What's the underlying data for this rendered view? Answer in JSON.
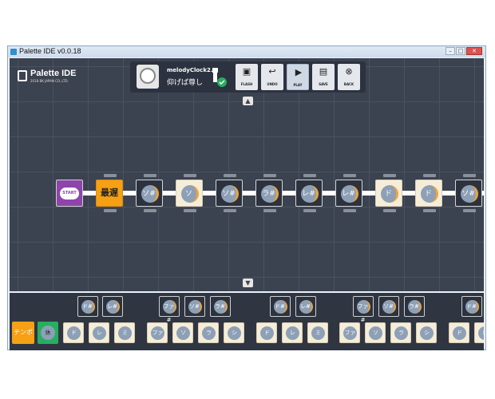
{
  "window": {
    "title": "Palette IDE v0.0.18"
  },
  "logo": {
    "name": "Palette IDE",
    "sub": "2018 BK JAPAN CO.,LTD."
  },
  "device": {
    "name": "melodyClock2.0",
    "song": "仰げば尊し"
  },
  "toolbar": {
    "buttons": [
      {
        "label": "FLASH",
        "icon": "chip-icon"
      },
      {
        "label": "UNDO",
        "icon": "undo-icon"
      },
      {
        "label": "PLAY",
        "icon": "play-icon"
      },
      {
        "label": "SAVE",
        "icon": "save-icon"
      },
      {
        "label": "BACK",
        "icon": "close-circle-icon"
      }
    ]
  },
  "sequence": {
    "start_label": "START",
    "tempo_label": "最遅",
    "notes": [
      "ソ#",
      "ソ",
      "ソ#",
      "ラ#",
      "レ#",
      "レ#",
      "ド",
      "ド",
      "ソ#"
    ]
  },
  "palette": {
    "tempo_label": "テンポ",
    "rest_label": "休",
    "sharps": [
      "ド#",
      "レ#",
      "ファ#",
      "ソ#",
      "ラ#",
      "ド#",
      "レ#",
      "ファ#",
      "ソ#",
      "ラ#",
      "ド#"
    ],
    "naturals": [
      "ド",
      "レ",
      "ミ",
      "ファ",
      "ソ",
      "ラ",
      "シ",
      "ド",
      "レ",
      "ミ",
      "ファ",
      "ソ",
      "ラ",
      "シ",
      "ド",
      "レ"
    ]
  }
}
